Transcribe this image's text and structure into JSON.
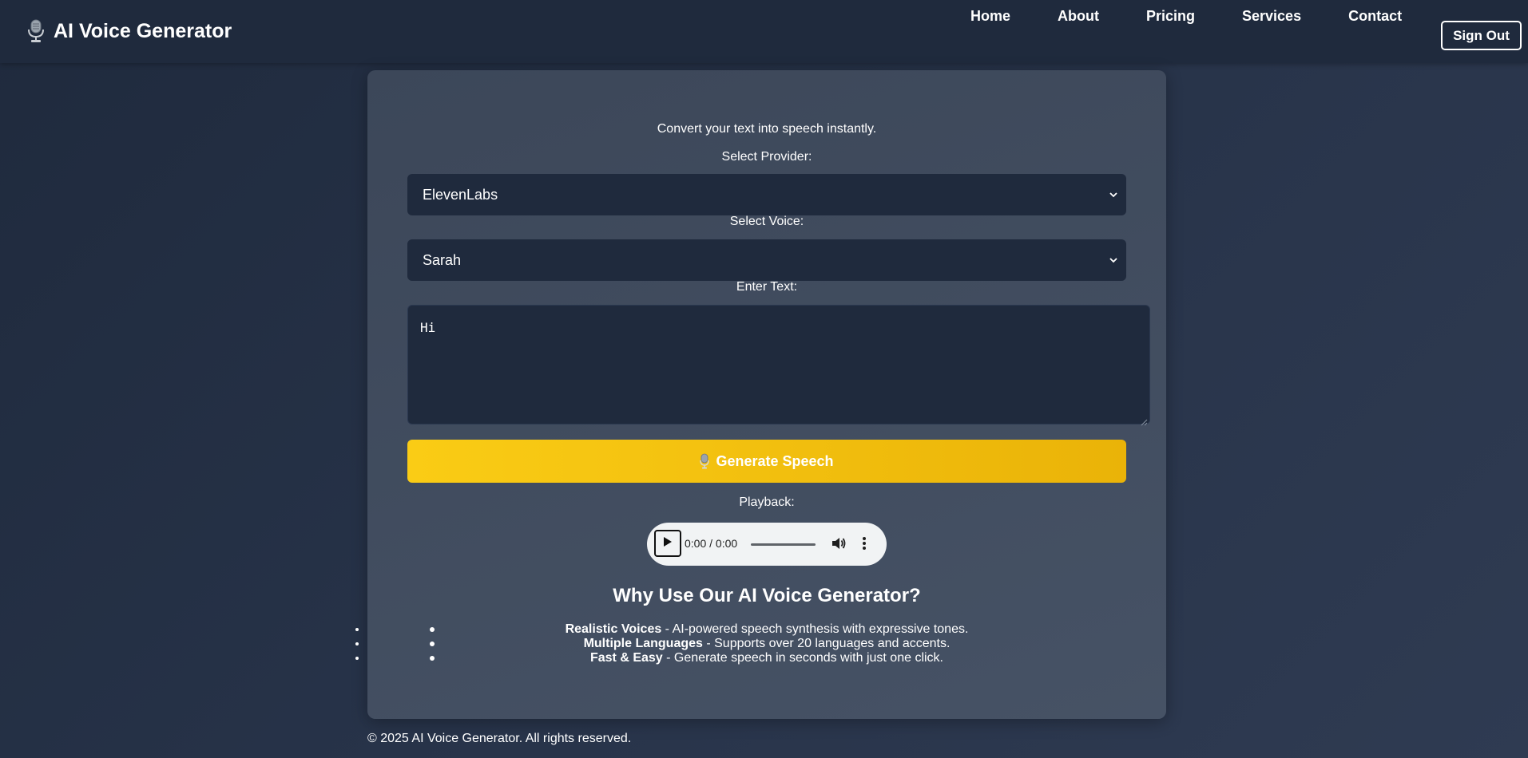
{
  "header": {
    "brand_title": "AI Voice Generator",
    "brand_icon": "microphone-icon",
    "nav": [
      "Home",
      "About",
      "Pricing",
      "Services",
      "Contact"
    ],
    "signout_label": "Sign Out"
  },
  "main": {
    "subtitle": "Convert your text into speech instantly.",
    "provider_label": "Select Provider:",
    "provider_value": "ElevenLabs",
    "voice_label": "Select Voice:",
    "voice_value": "Sarah",
    "text_label": "Enter Text:",
    "text_value": "Hi",
    "generate_label": "Generate Speech",
    "generate_icon": "microphone-icon",
    "playback_label": "Playback:",
    "audio": {
      "time": "0:00 / 0:00",
      "progress": 0
    }
  },
  "why": {
    "title": "Why Use Our AI Voice Generator?",
    "features": [
      {
        "bold": "Realistic Voices",
        "rest": " - AI-powered speech synthesis with expressive tones."
      },
      {
        "bold": "Multiple Languages",
        "rest": " - Supports over 20 languages and accents."
      },
      {
        "bold": "Fast & Easy",
        "rest": " - Generate speech in seconds with just one click."
      }
    ]
  },
  "footer": {
    "text": "© 2025 AI Voice Generator. All rights reserved."
  },
  "colors": {
    "background": "#1f2a3d",
    "card": "#3e4a5d",
    "input_bg": "#1f2a3d",
    "accent": "#facc15"
  }
}
